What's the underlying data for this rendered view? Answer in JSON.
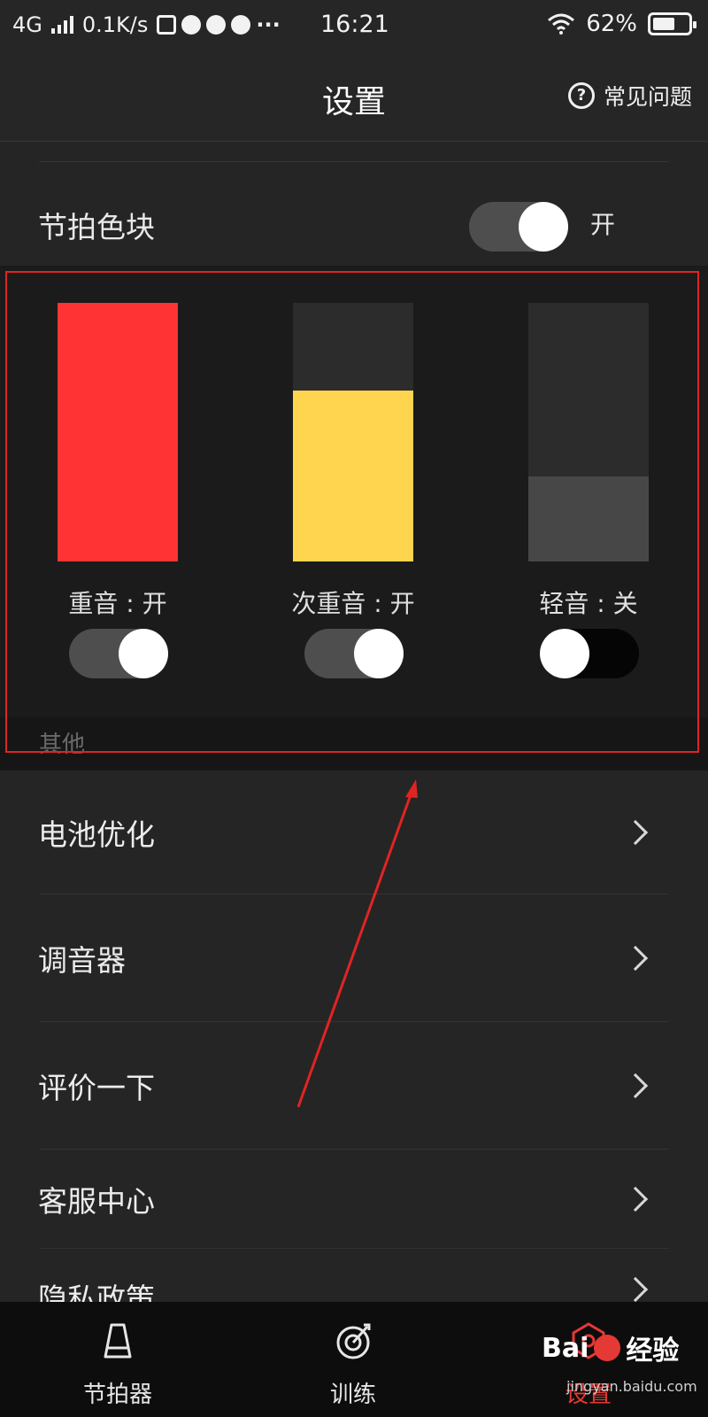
{
  "status_bar": {
    "network": "4G",
    "speed": "0.1K/s",
    "time": "16:21",
    "battery": "62%",
    "battery_level": 0.62
  },
  "nav": {
    "title": "设置",
    "faq_label": "常见问题"
  },
  "beat_color": {
    "label": "节拍色块",
    "state": "开",
    "enabled": true
  },
  "blocks": [
    {
      "label": "重音 : 开",
      "color": "#ff3333",
      "level": 1.0,
      "enabled": true
    },
    {
      "label": "次重音 : 开",
      "color": "#ffd54f",
      "level": 0.66,
      "enabled": true
    },
    {
      "label": "轻音 : 关",
      "color": "#474747",
      "level": 0.33,
      "enabled": false
    }
  ],
  "other_section_label": "其他",
  "list_items": [
    {
      "label": "电池优化"
    },
    {
      "label": "调音器"
    },
    {
      "label": "评价一下"
    },
    {
      "label": "客服中心"
    },
    {
      "label": "隐私政策"
    }
  ],
  "tabs": [
    {
      "label": "节拍器",
      "icon": "metronome-icon"
    },
    {
      "label": "训练",
      "icon": "target-icon"
    },
    {
      "label": "设置",
      "icon": "settings-hexagon-icon",
      "active": true
    }
  ],
  "watermark": {
    "brand": "Bai",
    "brand_tail": "经验",
    "url": "jingyan.baidu.com"
  },
  "colors": {
    "accent": "#e53935",
    "background": "#252525",
    "annotation": "#e02424"
  }
}
